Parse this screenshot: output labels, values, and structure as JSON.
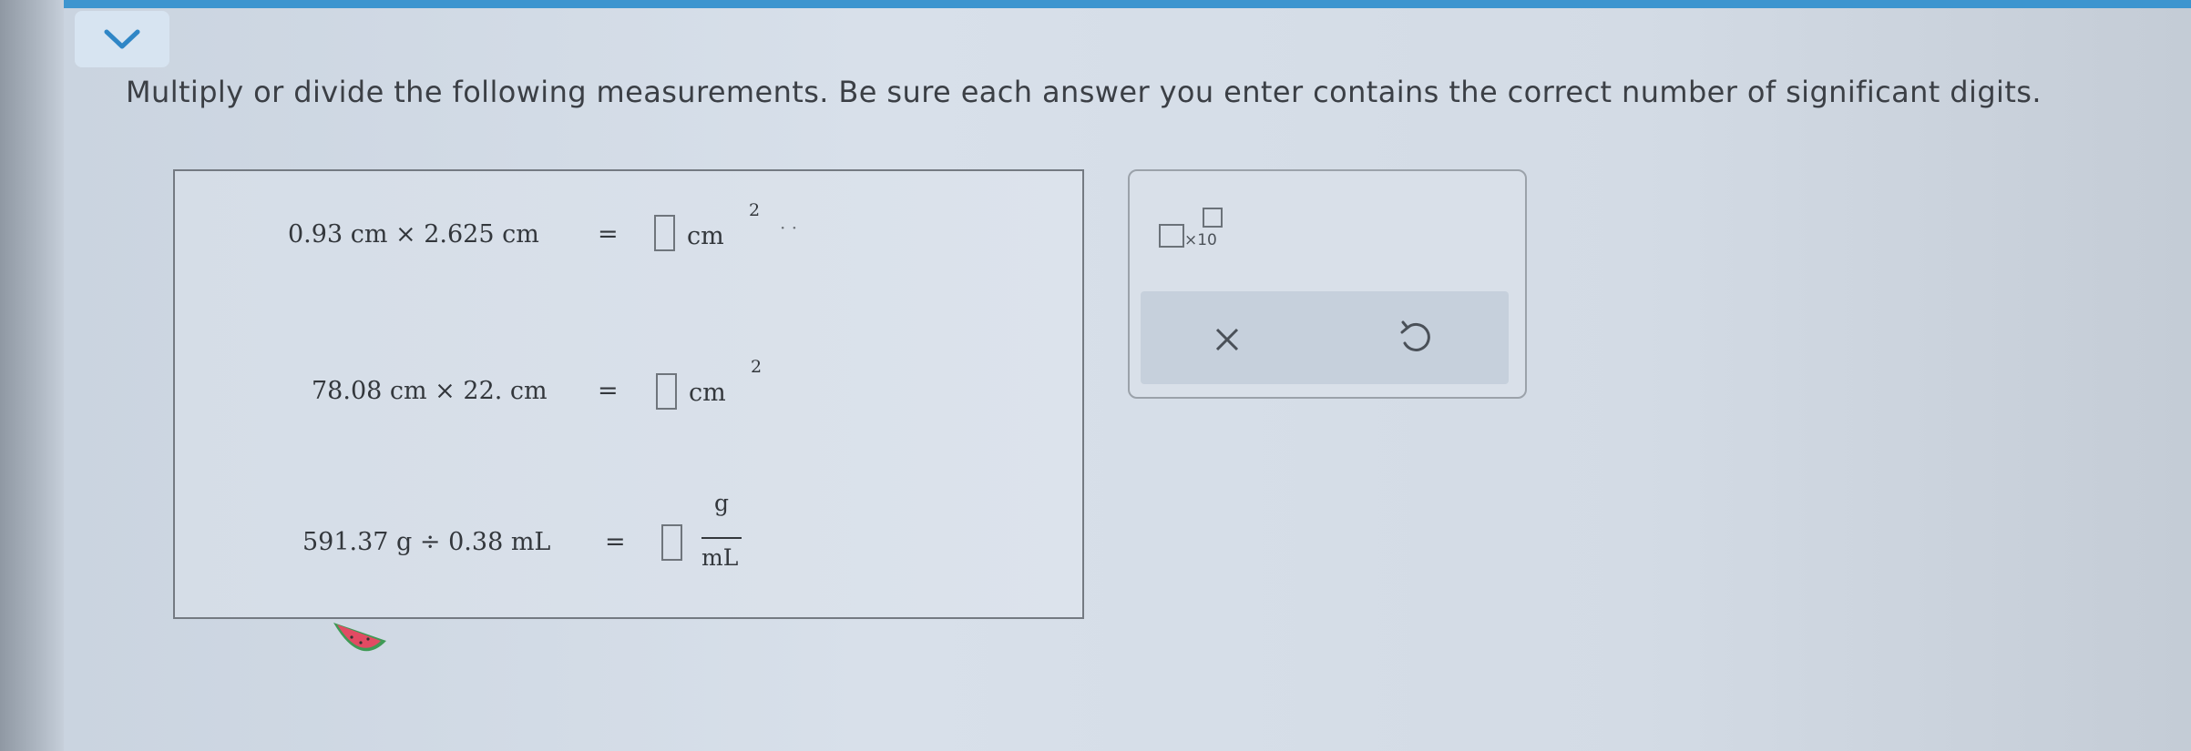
{
  "prompt": {
    "text": "Multiply or divide the following measurements. Be sure each answer you enter contains the correct number of significant digits."
  },
  "problems": [
    {
      "expression": "0.93 cm × 2.625 cm",
      "equals": "=",
      "unit": "cm",
      "exponent": "2"
    },
    {
      "expression": "78.08 cm × 22. cm",
      "equals": "=",
      "unit": "cm",
      "exponent": "2"
    },
    {
      "expression": "591.37 g ÷ 0.38 mL",
      "equals": "=",
      "unit_numerator": "g",
      "unit_denominator": "mL"
    }
  ],
  "tools": {
    "sci_notation_label": "×10"
  },
  "colors": {
    "top_bar": "#3d95cf",
    "collapse_button": "#d7e4f1",
    "action_bar": "#c6d0dc"
  },
  "icons": [
    "chevron-down-icon",
    "close-icon",
    "undo-icon"
  ]
}
